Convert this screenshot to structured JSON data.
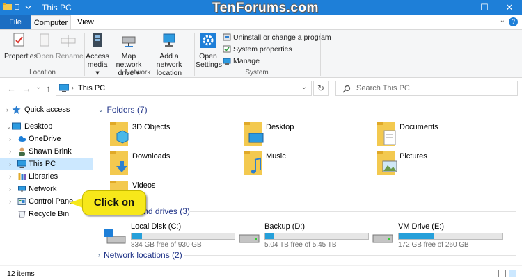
{
  "window": {
    "title": "This PC",
    "watermark": "TenForums.com",
    "minimize_glyph": "—",
    "maximize_glyph": "☐",
    "close_glyph": "✕"
  },
  "ribbon_tabs": {
    "file": "File",
    "computer": "Computer",
    "view": "View",
    "collapse_glyph": "⌄",
    "help_glyph": "?"
  },
  "ribbon": {
    "location": {
      "label": "Location",
      "properties": "Properties",
      "open": "Open",
      "rename": "Rename"
    },
    "network": {
      "label": "Network",
      "access_media_line1": "Access",
      "access_media_line2": "media ▾",
      "map_drive_line1": "Map network",
      "map_drive_line2": "drive ▾",
      "add_location_line1": "Add a network",
      "add_location_line2": "location"
    },
    "system": {
      "label": "System",
      "open_settings_line1": "Open",
      "open_settings_line2": "Settings",
      "uninstall": "Uninstall or change a program",
      "system_properties": "System properties",
      "manage": "Manage"
    }
  },
  "navigation": {
    "back_glyph": "←",
    "forward_glyph": "→",
    "recent_glyph": "⌄",
    "up_glyph": "↑",
    "address": "This PC",
    "address_chevron": "⌄",
    "refresh_glyph": "↻",
    "search_placeholder": "Search This PC"
  },
  "nav_pane": {
    "quick_access": "Quick access",
    "desktop": "Desktop",
    "onedrive": "OneDrive",
    "user": "Shawn Brink",
    "this_pc": "This PC",
    "libraries": "Libraries",
    "network": "Network",
    "control_panel": "Control Panel",
    "recycle_bin": "Recycle Bin"
  },
  "content": {
    "folders_header": "Folders (7)",
    "folders": [
      {
        "name": "3D Objects",
        "icon": "3d-objects-folder-icon"
      },
      {
        "name": "Desktop",
        "icon": "desktop-folder-icon"
      },
      {
        "name": "Documents",
        "icon": "documents-folder-icon"
      },
      {
        "name": "Downloads",
        "icon": "downloads-folder-icon"
      },
      {
        "name": "Music",
        "icon": "music-folder-icon"
      },
      {
        "name": "Pictures",
        "icon": "pictures-folder-icon"
      },
      {
        "name": "Videos",
        "icon": "videos-folder-icon"
      }
    ],
    "drives_header": "Devices and drives (3)",
    "drives": [
      {
        "name": "Local Disk (C:)",
        "free": "834 GB free of 930 GB",
        "used_fraction": 0.1
      },
      {
        "name": "Backup (D:)",
        "free": "5.04 TB free of 5.45 TB",
        "used_fraction": 0.08
      },
      {
        "name": "VM Drive (E:)",
        "free": "172 GB free of 260 GB",
        "used_fraction": 0.34
      }
    ],
    "network_header": "Network locations (2)"
  },
  "callout": {
    "text": "Click on"
  },
  "status_bar": {
    "item_count": "12 items"
  },
  "colors": {
    "titlebar": "#1e7fd8",
    "file_tab": "#1c6ec2",
    "selection": "#cce8ff",
    "drive_bar": "#26a0da",
    "callout": "#f7e81a",
    "folder": "#f3c94f"
  }
}
